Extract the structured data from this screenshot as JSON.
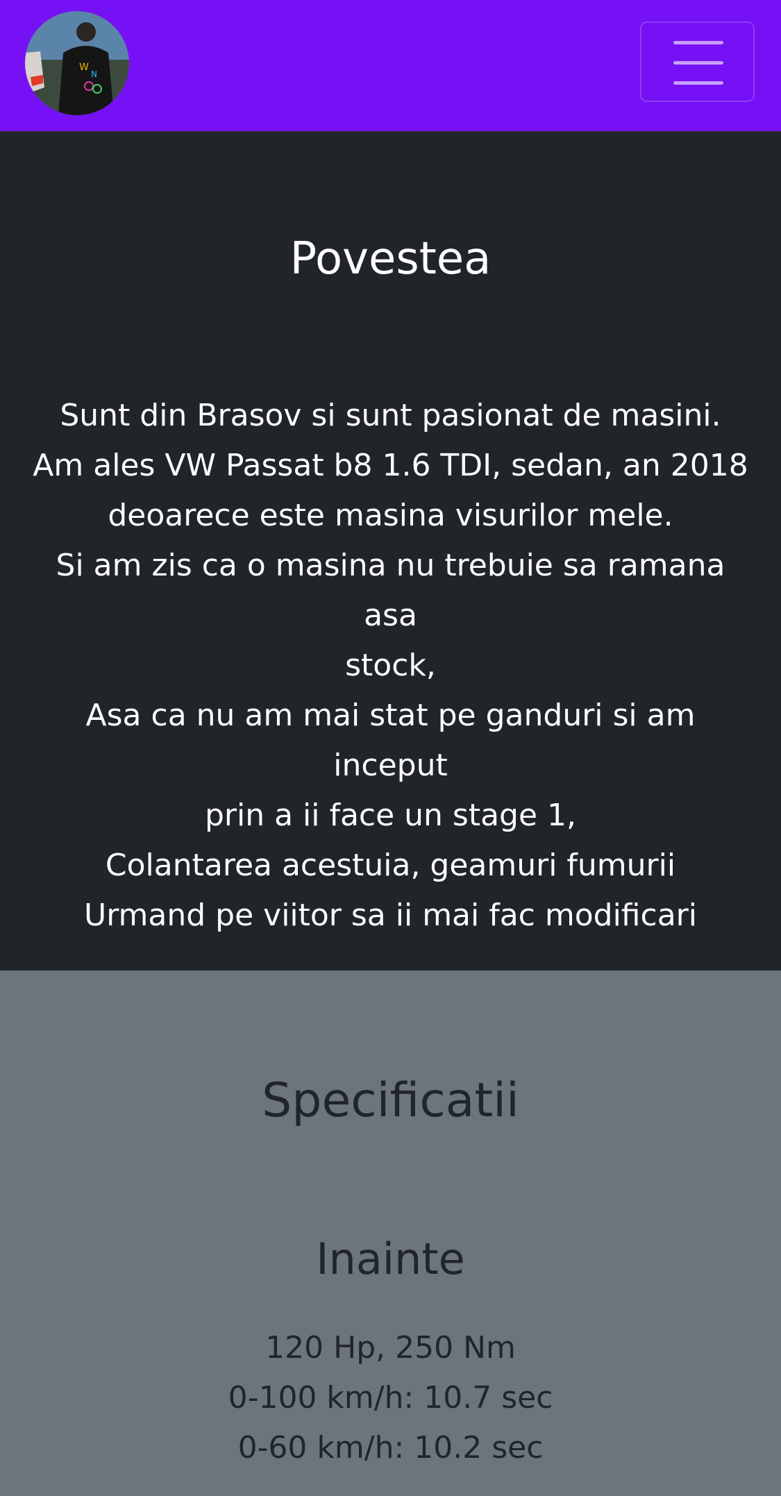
{
  "navbar": {
    "brand_color": "#7611f5",
    "avatar_icon": "avatar-photo",
    "menu_icon": "hamburger-menu-icon"
  },
  "story": {
    "title": "Povestea",
    "lines": [
      "Sunt din Brasov si sunt pasionat de masini.",
      "Am ales VW Passat b8 1.6 TDI, sedan, an 2018",
      "deoarece este masina visurilor mele.",
      "Si am zis ca o masina nu trebuie sa ramana asa",
      "stock,",
      "Asa ca nu am mai stat pe ganduri si am inceput",
      "prin a ii face un stage 1,",
      "Colantarea acestuia, geamuri fumurii",
      "Urmand pe viitor sa ii mai fac modificari"
    ]
  },
  "specs": {
    "title": "Specificatii",
    "subtitle": "Inainte",
    "items": [
      "120 Hp, 250 Nm",
      "0-100 km/h: 10.7 sec",
      "0-60 km/h: 10.2 sec"
    ]
  },
  "colors": {
    "story_bg": "#212529",
    "specs_bg": "#6c757d"
  }
}
